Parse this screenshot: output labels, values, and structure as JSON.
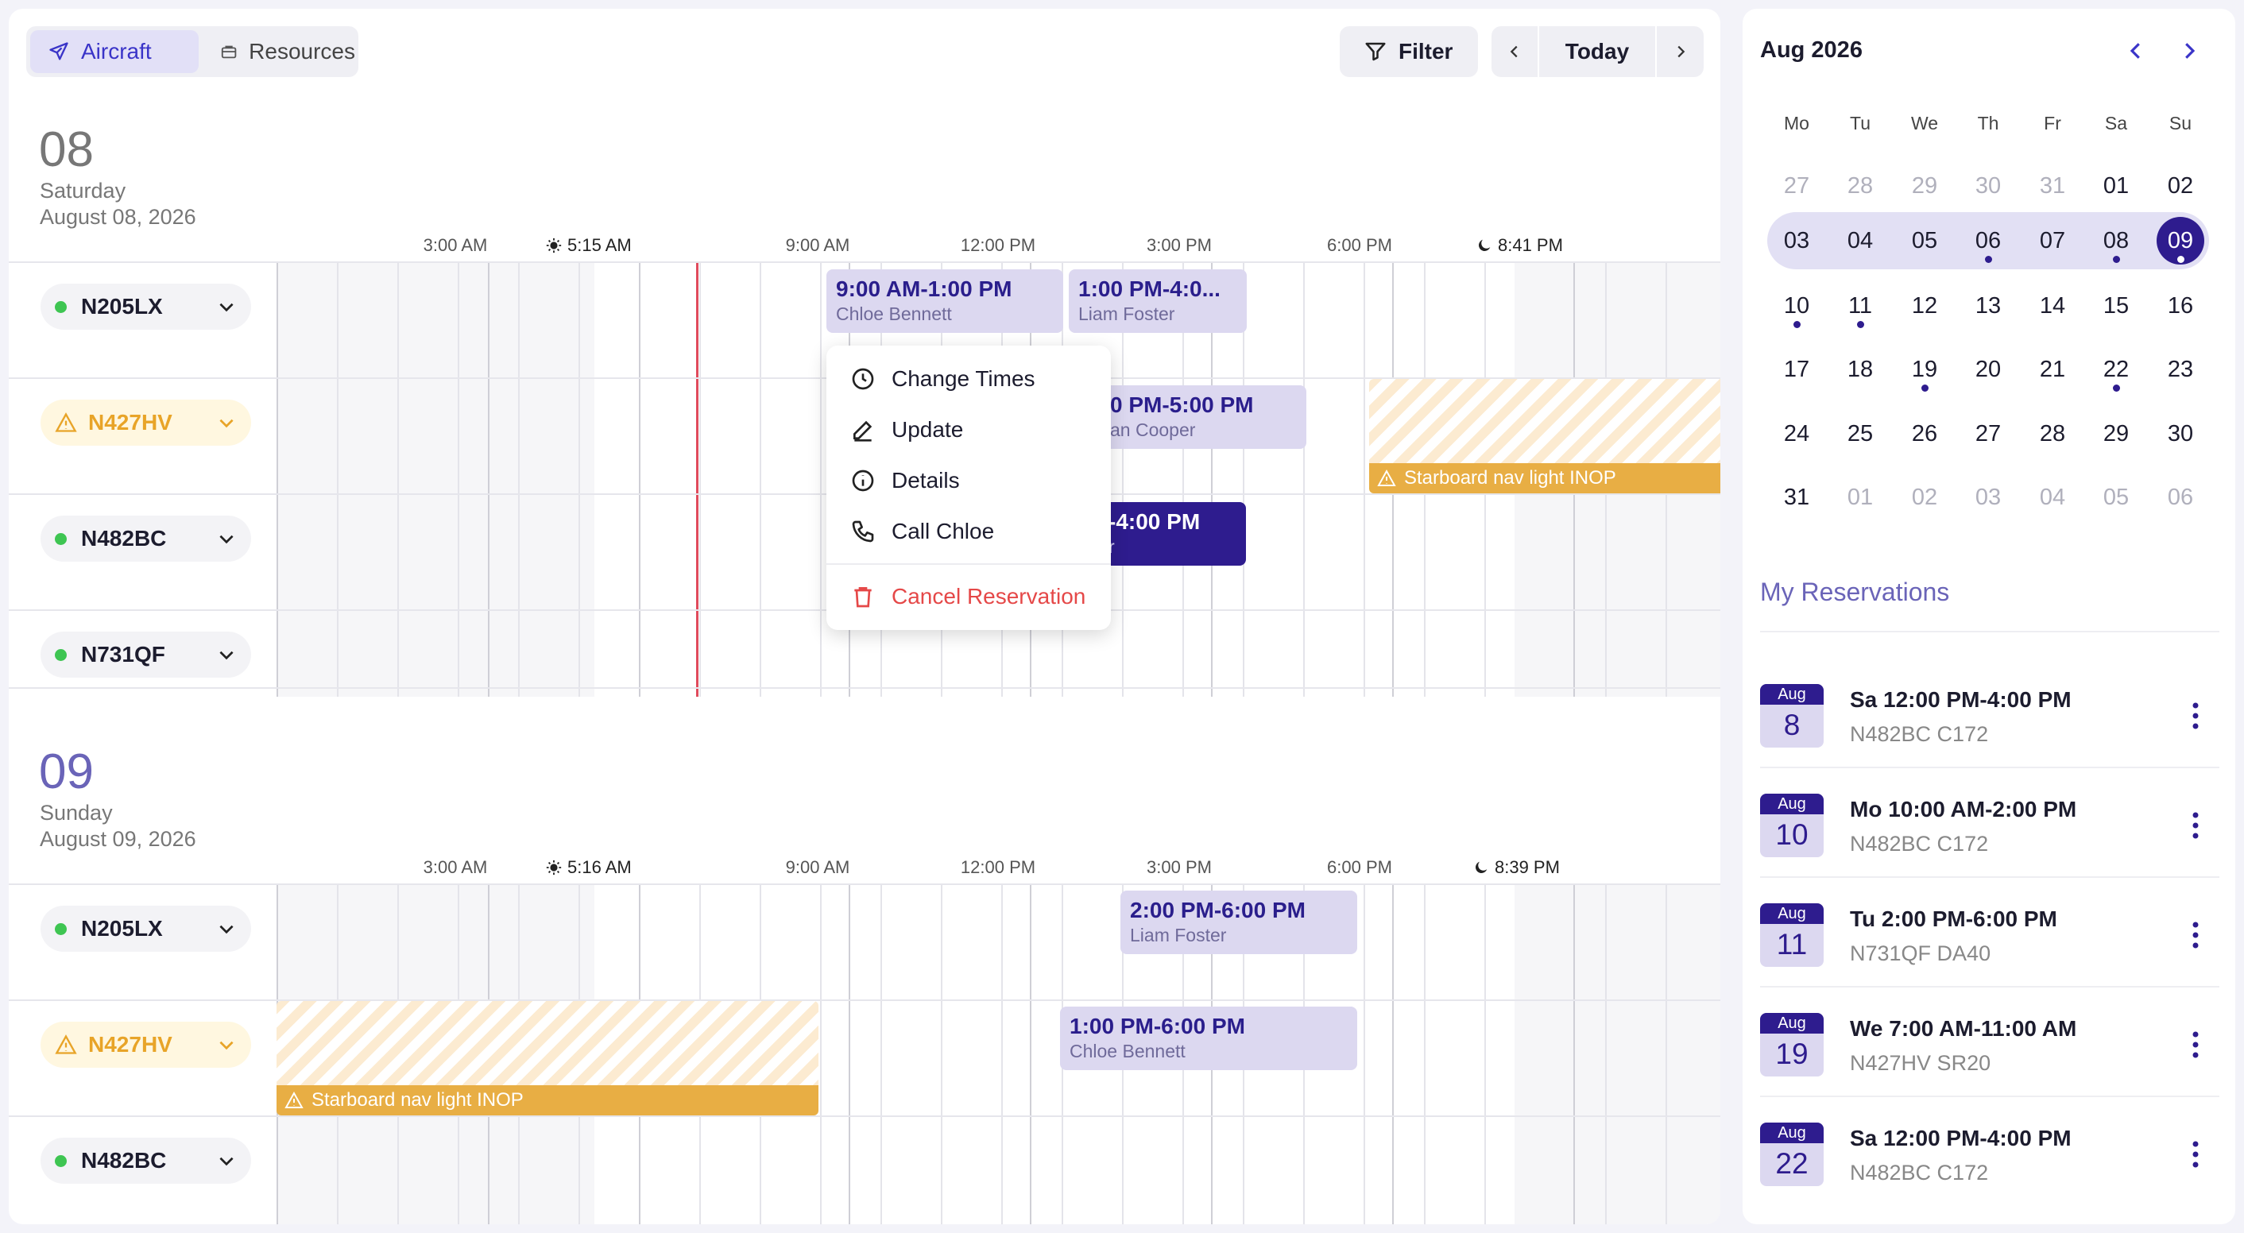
{
  "toolbar": {
    "tabs": [
      {
        "label": "Aircraft",
        "icon": "plane-icon"
      },
      {
        "label": "Resources",
        "icon": "briefcase-icon"
      }
    ],
    "filter_label": "Filter",
    "today_label": "Today"
  },
  "days": [
    {
      "num": "08",
      "weekday": "Saturday",
      "date": "August 08, 2026",
      "times": [
        "3:00 AM",
        "9:00 AM",
        "12:00 PM",
        "3:00 PM",
        "6:00 PM"
      ],
      "sunrise": "5:15 AM",
      "sunset": "8:41 PM",
      "aircraft": [
        "N205LX",
        "N427HV",
        "N482BC",
        "N731QF"
      ],
      "reservations": [
        {
          "time": "9:00 AM-1:00 PM",
          "name": "Chloe Bennett"
        },
        {
          "time": "1:00 PM-4:0...",
          "name": "Liam Foster"
        },
        {
          "time": "0 PM-5:00 PM",
          "name": "an Cooper"
        },
        {
          "time": "-4:00 PM",
          "name": "r"
        }
      ],
      "maintenance": "Starboard nav light INOP"
    },
    {
      "num": "09",
      "weekday": "Sunday",
      "date": "August 09, 2026",
      "times": [
        "3:00 AM",
        "9:00 AM",
        "12:00 PM",
        "3:00 PM",
        "6:00 PM"
      ],
      "sunrise": "5:16 AM",
      "sunset": "8:39 PM",
      "aircraft": [
        "N205LX",
        "N427HV",
        "N482BC"
      ],
      "reservations": [
        {
          "time": "2:00 PM-6:00 PM",
          "name": "Liam Foster"
        },
        {
          "time": "1:00 PM-6:00 PM",
          "name": "Chloe Bennett"
        }
      ],
      "maintenance": "Starboard nav light INOP"
    }
  ],
  "context_menu": [
    "Change Times",
    "Update",
    "Details",
    "Call Chloe",
    "Cancel Reservation"
  ],
  "calendar": {
    "title": "Aug 2026",
    "weekdays": [
      "Mo",
      "Tu",
      "We",
      "Th",
      "Fr",
      "Sa",
      "Su"
    ],
    "weeks": [
      [
        "27",
        "28",
        "29",
        "30",
        "31",
        "01",
        "02"
      ],
      [
        "03",
        "04",
        "05",
        "06",
        "07",
        "08",
        "09"
      ],
      [
        "10",
        "11",
        "12",
        "13",
        "14",
        "15",
        "16"
      ],
      [
        "17",
        "18",
        "19",
        "20",
        "21",
        "22",
        "23"
      ],
      [
        "24",
        "25",
        "26",
        "27",
        "28",
        "29",
        "30"
      ],
      [
        "31",
        "01",
        "02",
        "03",
        "04",
        "05",
        "06"
      ]
    ],
    "selected": "09"
  },
  "my_reservations": {
    "title": "My Reservations",
    "items": [
      {
        "month": "Aug",
        "day": "8",
        "title": "Sa 12:00 PM-4:00 PM",
        "sub": "N482BC C172"
      },
      {
        "month": "Aug",
        "day": "10",
        "title": "Mo 10:00 AM-2:00 PM",
        "sub": "N482BC C172"
      },
      {
        "month": "Aug",
        "day": "11",
        "title": "Tu 2:00 PM-6:00 PM",
        "sub": "N731QF DA40"
      },
      {
        "month": "Aug",
        "day": "19",
        "title": "We 7:00 AM-11:00 AM",
        "sub": "N427HV SR20"
      },
      {
        "month": "Aug",
        "day": "22",
        "title": "Sa 12:00 PM-4:00 PM",
        "sub": "N482BC C172"
      }
    ]
  }
}
